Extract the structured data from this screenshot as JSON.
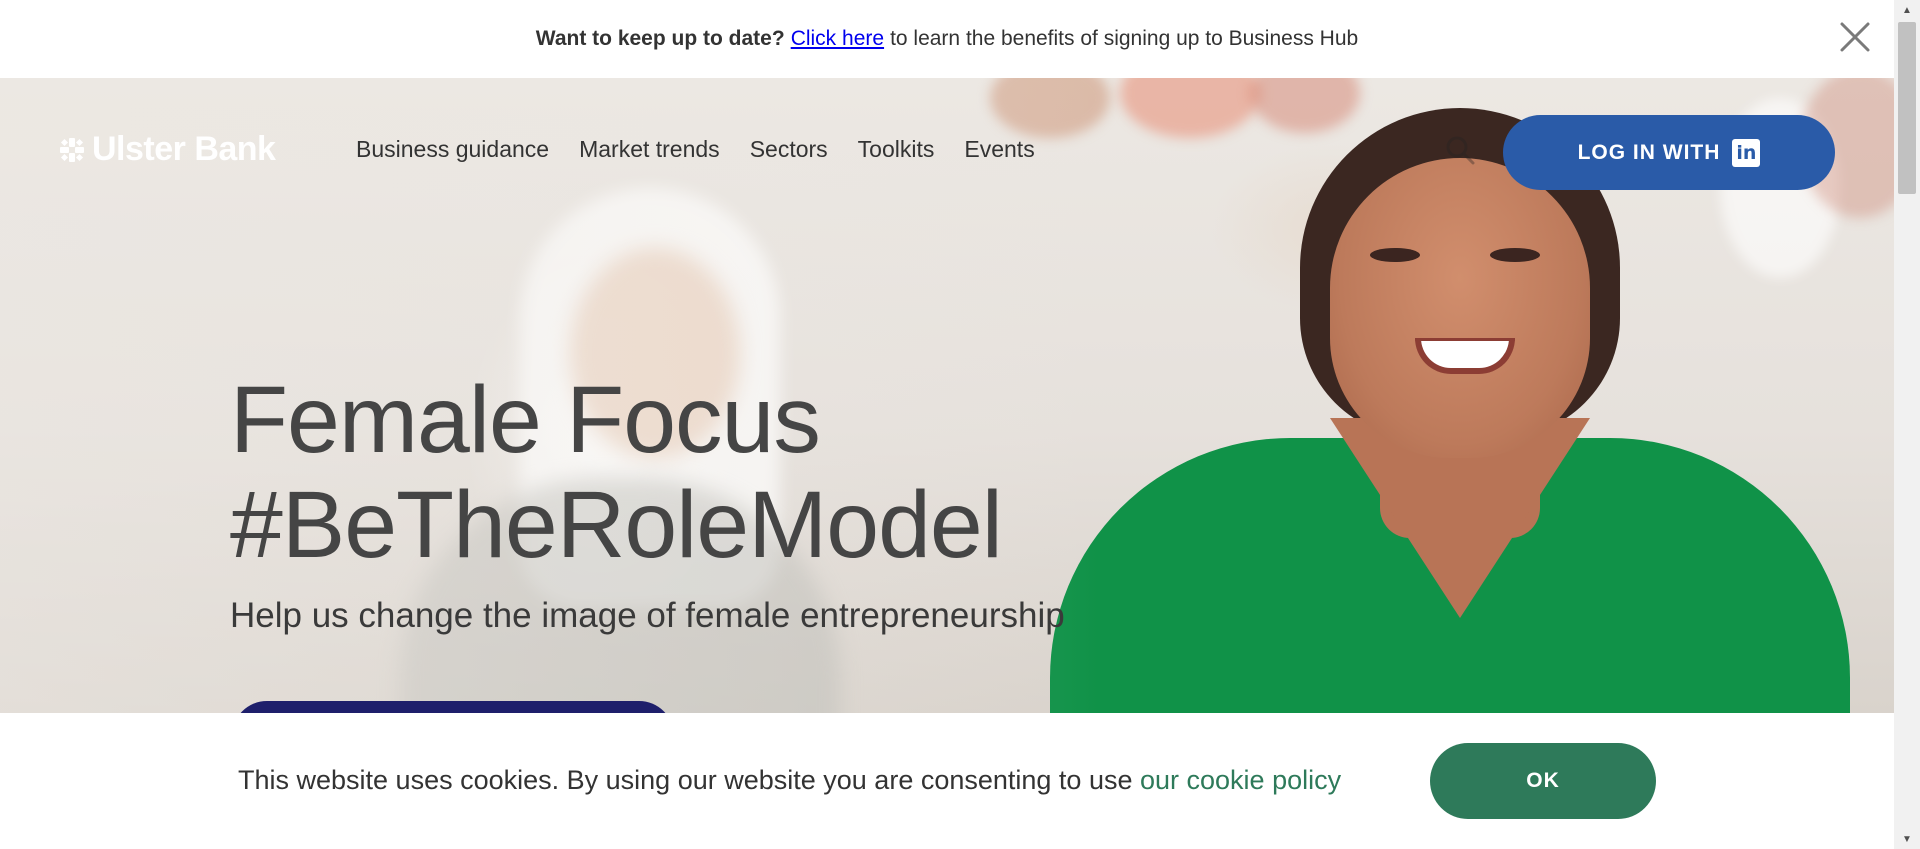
{
  "notice": {
    "lead": "Want to keep up to date?",
    "link": "Click here",
    "rest": "to learn the benefits of signing up to Business Hub",
    "close_icon": "close-icon"
  },
  "header": {
    "logo_text": "Ulster Bank",
    "nav": [
      {
        "label": "Business guidance"
      },
      {
        "label": "Market trends"
      },
      {
        "label": "Sectors"
      },
      {
        "label": "Toolkits"
      },
      {
        "label": "Events"
      }
    ],
    "search_icon": "search-icon",
    "login_label": "LOG IN WITH",
    "login_icon": "linkedin-icon",
    "login_icon_glyph": "in"
  },
  "hero": {
    "title_line1": "Female Focus",
    "title_line2": "#BeTheRoleModel",
    "subtitle": "Help us change the image of female entrepreneurship"
  },
  "cookie": {
    "text": "This website uses cookies. By using our website you are consenting to use",
    "link": "our cookie policy",
    "ok_label": "OK"
  },
  "colors": {
    "login_button": "#2a5ba8",
    "cta_button": "#1e1f6b",
    "cookie_ok": "#2e7a5a",
    "link_green": "#2e7a5a"
  }
}
